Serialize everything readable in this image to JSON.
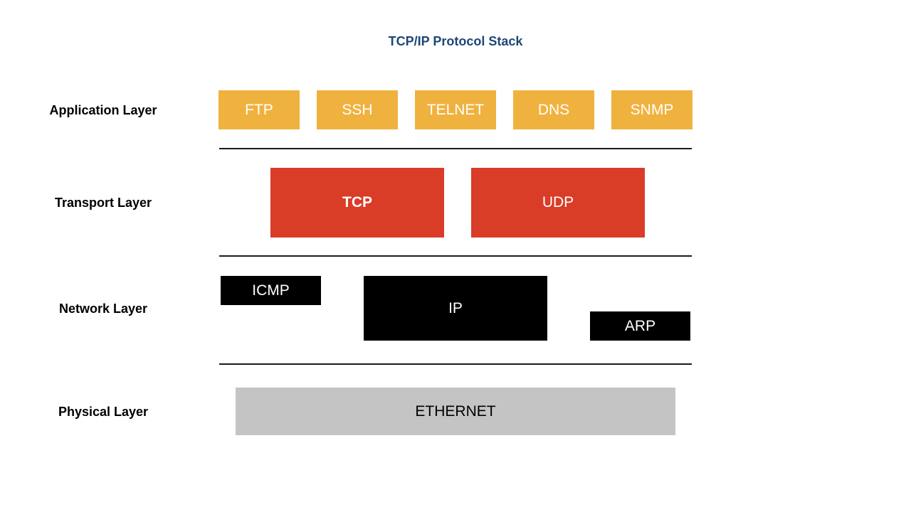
{
  "title": "TCP/IP Protocol Stack",
  "colors": {
    "title": "#1d4777",
    "application": "#f0b23e",
    "transport": "#d93c27",
    "network": "#000000",
    "physical": "#c4c4c4"
  },
  "layers": {
    "application": {
      "label": "Application Layer",
      "protocols": [
        "FTP",
        "SSH",
        "TELNET",
        "DNS",
        "SNMP"
      ]
    },
    "transport": {
      "label": "Transport Layer",
      "protocols": [
        "TCP",
        "UDP"
      ]
    },
    "network": {
      "label": "Network Layer",
      "protocols": [
        "ICMP",
        "IP",
        "ARP"
      ]
    },
    "physical": {
      "label": "Physical Layer",
      "protocols": [
        "ETHERNET"
      ]
    }
  }
}
